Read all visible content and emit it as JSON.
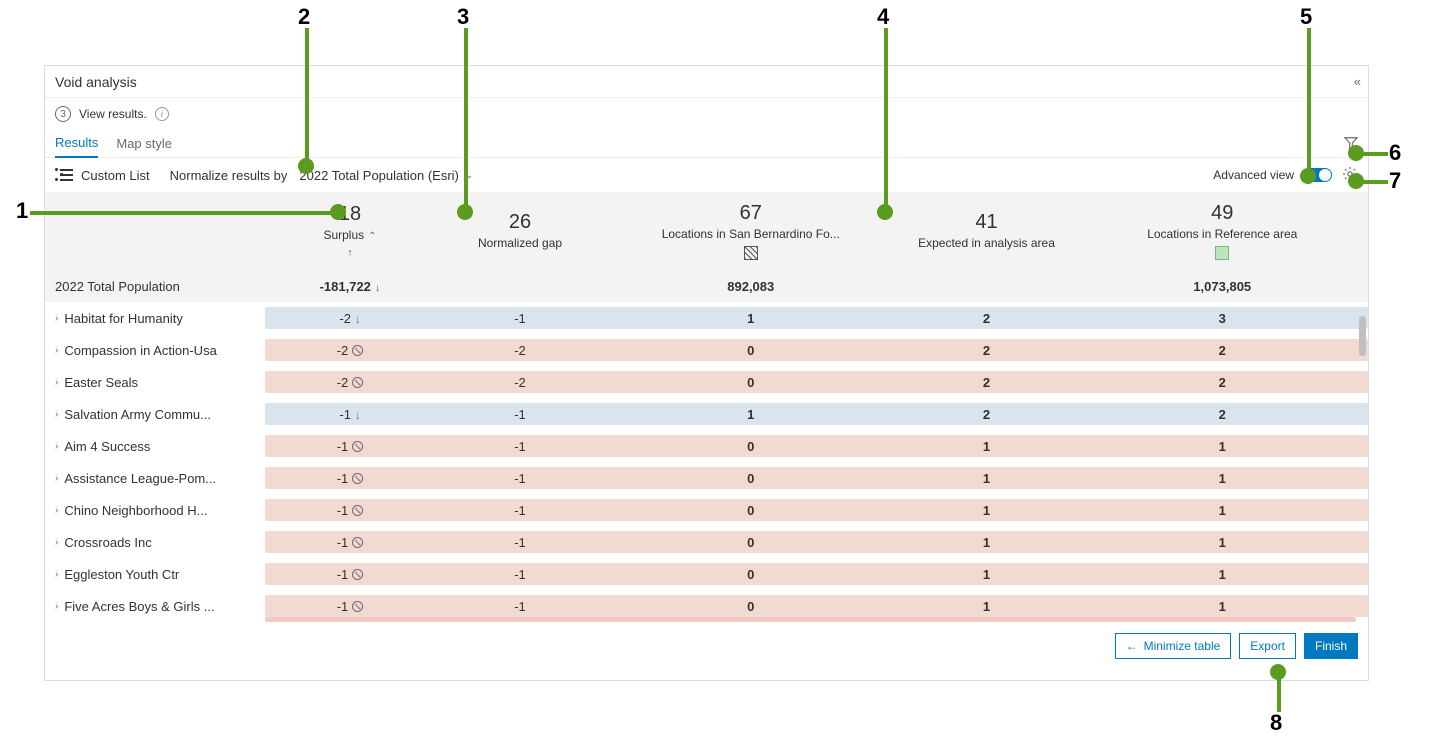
{
  "panel": {
    "title": "Void analysis"
  },
  "step": {
    "num": "3",
    "text": "View results."
  },
  "tabs": {
    "results": "Results",
    "mapstyle": "Map style"
  },
  "toolbar": {
    "custom_list": "Custom List",
    "normalize_label": "Normalize results by",
    "normalize_value": "2022 Total Population (Esri)",
    "advanced_label": "Advanced view"
  },
  "headers": {
    "surplus_num": "18",
    "surplus_label": "Surplus",
    "normgap_num": "26",
    "normgap_label": "Normalized gap",
    "locsan_num": "67",
    "locsan_label": "Locations in San Bernardino Fo...",
    "expected_num": "41",
    "expected_label": "Expected in analysis area",
    "locref_num": "49",
    "locref_label": "Locations in Reference area"
  },
  "totals": {
    "label": "2022 Total Population",
    "surplus": "-181,722",
    "locsan": "892,083",
    "locref": "1,073,805"
  },
  "rows": [
    {
      "label": "Habitat for Humanity",
      "surplus": "-2",
      "icon": "down",
      "normgap": "-1",
      "locsan": "1",
      "expected": "2",
      "locref": "3",
      "tone": "blue"
    },
    {
      "label": "Compassion in Action-Usa",
      "surplus": "-2",
      "icon": "null",
      "normgap": "-2",
      "locsan": "0",
      "expected": "2",
      "locref": "2",
      "tone": "pink"
    },
    {
      "label": "Easter Seals",
      "surplus": "-2",
      "icon": "null",
      "normgap": "-2",
      "locsan": "0",
      "expected": "2",
      "locref": "2",
      "tone": "pink"
    },
    {
      "label": "Salvation Army Commu...",
      "surplus": "-1",
      "icon": "down",
      "normgap": "-1",
      "locsan": "1",
      "expected": "2",
      "locref": "2",
      "tone": "blue"
    },
    {
      "label": "Aim 4 Success",
      "surplus": "-1",
      "icon": "null",
      "normgap": "-1",
      "locsan": "0",
      "expected": "1",
      "locref": "1",
      "tone": "pink"
    },
    {
      "label": "Assistance League-Pom...",
      "surplus": "-1",
      "icon": "null",
      "normgap": "-1",
      "locsan": "0",
      "expected": "1",
      "locref": "1",
      "tone": "pink"
    },
    {
      "label": "Chino Neighborhood H...",
      "surplus": "-1",
      "icon": "null",
      "normgap": "-1",
      "locsan": "0",
      "expected": "1",
      "locref": "1",
      "tone": "pink"
    },
    {
      "label": "Crossroads Inc",
      "surplus": "-1",
      "icon": "null",
      "normgap": "-1",
      "locsan": "0",
      "expected": "1",
      "locref": "1",
      "tone": "pink"
    },
    {
      "label": "Eggleston Youth Ctr",
      "surplus": "-1",
      "icon": "null",
      "normgap": "-1",
      "locsan": "0",
      "expected": "1",
      "locref": "1",
      "tone": "pink"
    },
    {
      "label": "Five Acres Boys & Girls ...",
      "surplus": "-1",
      "icon": "null",
      "normgap": "-1",
      "locsan": "0",
      "expected": "1",
      "locref": "1",
      "tone": "pink"
    }
  ],
  "footer": {
    "minimize": "Minimize table",
    "export": "Export",
    "finish": "Finish"
  },
  "callouts": [
    "1",
    "2",
    "3",
    "4",
    "5",
    "6",
    "7",
    "8"
  ]
}
